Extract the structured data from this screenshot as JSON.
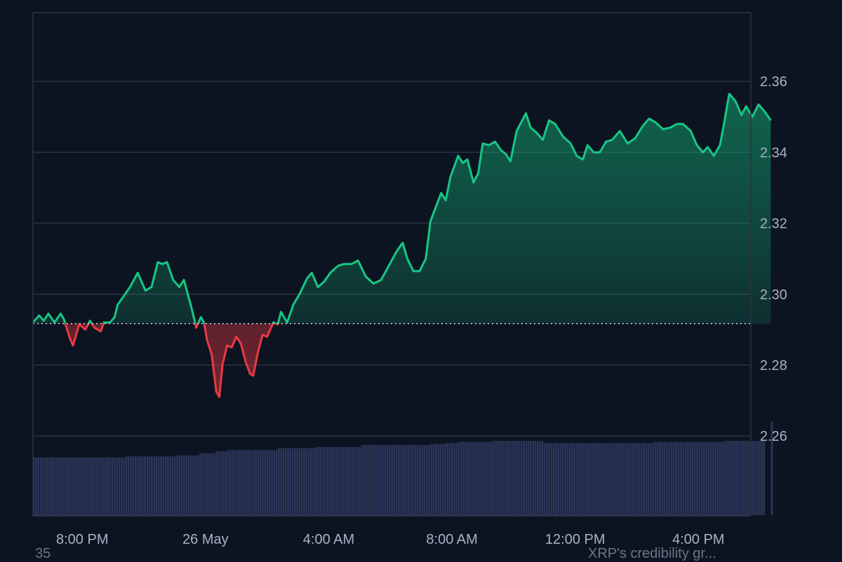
{
  "colors": {
    "background": "#0d1421",
    "grid": "#2b3242",
    "up": "#16c784",
    "down": "#ea3943",
    "volume": "#2a3558",
    "tick": "#a9b2c4",
    "baseline": "#cfd6e4"
  },
  "footer": {
    "left_text": "35",
    "right_text": "XRP's credibility gr..."
  },
  "chart_data": {
    "type": "area",
    "title": "",
    "baseline": 2.2917,
    "ylim": [
      2.2375,
      2.3794
    ],
    "y_ticks": [
      2.26,
      2.28,
      2.3,
      2.32,
      2.34,
      2.36
    ],
    "y_tick_labels": [
      "2.26",
      "2.28",
      "2.30",
      "2.32",
      "2.34",
      "2.36"
    ],
    "x_range_hours": [
      -5.6,
      17.7
    ],
    "x_ticks": [
      {
        "h": -4,
        "label": "8:00 PM"
      },
      {
        "h": 0,
        "label": "26 May"
      },
      {
        "h": 4,
        "label": "4:00 AM"
      },
      {
        "h": 8,
        "label": "8:00 AM"
      },
      {
        "h": 12,
        "label": "12:00 PM"
      },
      {
        "h": 16,
        "label": "4:00 PM"
      }
    ],
    "price": [
      [
        -5.6,
        2.292
      ],
      [
        -5.4,
        2.294
      ],
      [
        -5.25,
        2.2925
      ],
      [
        -5.1,
        2.2945
      ],
      [
        -4.9,
        2.292
      ],
      [
        -4.7,
        2.2945
      ],
      [
        -4.6,
        2.293
      ],
      [
        -4.4,
        2.2875
      ],
      [
        -4.3,
        2.2855
      ],
      [
        -4.1,
        2.2915
      ],
      [
        -3.9,
        2.29
      ],
      [
        -3.75,
        2.2925
      ],
      [
        -3.6,
        2.2905
      ],
      [
        -3.4,
        2.2895
      ],
      [
        -3.3,
        2.292
      ],
      [
        -3.1,
        2.292
      ],
      [
        -2.95,
        2.2935
      ],
      [
        -2.85,
        2.297
      ],
      [
        -2.65,
        2.2995
      ],
      [
        -2.45,
        2.302
      ],
      [
        -2.2,
        2.306
      ],
      [
        -2.05,
        2.303
      ],
      [
        -1.95,
        2.301
      ],
      [
        -1.75,
        2.302
      ],
      [
        -1.55,
        2.309
      ],
      [
        -1.4,
        2.3085
      ],
      [
        -1.25,
        2.309
      ],
      [
        -1.05,
        2.304
      ],
      [
        -0.85,
        2.302
      ],
      [
        -0.7,
        2.304
      ],
      [
        -0.45,
        2.296
      ],
      [
        -0.3,
        2.2905
      ],
      [
        -0.15,
        2.2935
      ],
      [
        -0.05,
        2.292
      ],
      [
        0.05,
        2.287
      ],
      [
        0.2,
        2.283
      ],
      [
        0.35,
        2.2725
      ],
      [
        0.45,
        2.271
      ],
      [
        0.55,
        2.28
      ],
      [
        0.7,
        2.2855
      ],
      [
        0.85,
        2.285
      ],
      [
        1.0,
        2.288
      ],
      [
        1.15,
        2.286
      ],
      [
        1.3,
        2.281
      ],
      [
        1.45,
        2.2775
      ],
      [
        1.55,
        2.277
      ],
      [
        1.7,
        2.2835
      ],
      [
        1.85,
        2.2885
      ],
      [
        2.0,
        2.288
      ],
      [
        2.2,
        2.292
      ],
      [
        2.35,
        2.2915
      ],
      [
        2.45,
        2.295
      ],
      [
        2.65,
        2.292
      ],
      [
        2.85,
        2.297
      ],
      [
        3.05,
        2.3
      ],
      [
        3.3,
        2.3045
      ],
      [
        3.45,
        2.306
      ],
      [
        3.65,
        2.302
      ],
      [
        3.85,
        2.3035
      ],
      [
        4.05,
        2.306
      ],
      [
        4.3,
        2.308
      ],
      [
        4.5,
        2.3085
      ],
      [
        4.75,
        2.3085
      ],
      [
        4.95,
        2.3095
      ],
      [
        5.2,
        2.305
      ],
      [
        5.45,
        2.303
      ],
      [
        5.7,
        2.304
      ],
      [
        5.95,
        2.308
      ],
      [
        6.2,
        2.312
      ],
      [
        6.4,
        2.3145
      ],
      [
        6.55,
        2.31
      ],
      [
        6.75,
        2.3065
      ],
      [
        6.95,
        2.3065
      ],
      [
        7.15,
        2.31
      ],
      [
        7.3,
        2.3205
      ],
      [
        7.45,
        2.324
      ],
      [
        7.65,
        2.3285
      ],
      [
        7.8,
        2.3265
      ],
      [
        7.95,
        2.333
      ],
      [
        8.2,
        2.339
      ],
      [
        8.35,
        2.337
      ],
      [
        8.5,
        2.338
      ],
      [
        8.7,
        2.3315
      ],
      [
        8.85,
        2.334
      ],
      [
        9.0,
        2.3425
      ],
      [
        9.2,
        2.342
      ],
      [
        9.4,
        2.343
      ],
      [
        9.6,
        2.3405
      ],
      [
        9.75,
        2.3395
      ],
      [
        9.9,
        2.3375
      ],
      [
        10.1,
        2.346
      ],
      [
        10.25,
        2.3485
      ],
      [
        10.4,
        2.351
      ],
      [
        10.55,
        2.347
      ],
      [
        10.75,
        2.3455
      ],
      [
        10.95,
        2.3435
      ],
      [
        11.15,
        2.349
      ],
      [
        11.35,
        2.348
      ],
      [
        11.6,
        2.3445
      ],
      [
        11.85,
        2.3425
      ],
      [
        12.05,
        2.339
      ],
      [
        12.25,
        2.338
      ],
      [
        12.4,
        2.342
      ],
      [
        12.6,
        2.34
      ],
      [
        12.8,
        2.34
      ],
      [
        13.0,
        2.343
      ],
      [
        13.2,
        2.3435
      ],
      [
        13.45,
        2.346
      ],
      [
        13.7,
        2.3425
      ],
      [
        13.95,
        2.344
      ],
      [
        14.2,
        2.3475
      ],
      [
        14.4,
        2.3495
      ],
      [
        14.6,
        2.3485
      ],
      [
        14.85,
        2.3465
      ],
      [
        15.1,
        2.347
      ],
      [
        15.3,
        2.348
      ],
      [
        15.5,
        2.348
      ],
      [
        15.75,
        2.346
      ],
      [
        15.95,
        2.342
      ],
      [
        16.15,
        2.34
      ],
      [
        16.3,
        2.3415
      ],
      [
        16.5,
        2.339
      ],
      [
        16.7,
        2.342
      ],
      [
        16.85,
        2.349
      ],
      [
        17.0,
        2.3565
      ],
      [
        17.2,
        2.3545
      ],
      [
        17.4,
        2.3505
      ],
      [
        17.55,
        2.353
      ],
      [
        17.75,
        2.35
      ],
      [
        17.95,
        2.3535
      ],
      [
        18.15,
        2.3515
      ],
      [
        18.35,
        2.349
      ]
    ],
    "volume": [
      [
        -5.6,
        0.56
      ],
      [
        -2.6,
        0.57
      ],
      [
        -1.0,
        0.58
      ],
      [
        -0.2,
        0.6
      ],
      [
        0.3,
        0.62
      ],
      [
        0.7,
        0.63
      ],
      [
        2.3,
        0.65
      ],
      [
        3.5,
        0.66
      ],
      [
        5.0,
        0.68
      ],
      [
        7.3,
        0.69
      ],
      [
        7.8,
        0.7
      ],
      [
        8.2,
        0.71
      ],
      [
        9.3,
        0.72
      ],
      [
        10.9,
        0.7
      ],
      [
        13.0,
        0.7
      ],
      [
        14.5,
        0.71
      ],
      [
        16.8,
        0.72
      ],
      [
        18.1,
        0.72
      ]
    ],
    "volume_max_ratio": 1.0,
    "volume_last_spike": 18.35
  }
}
